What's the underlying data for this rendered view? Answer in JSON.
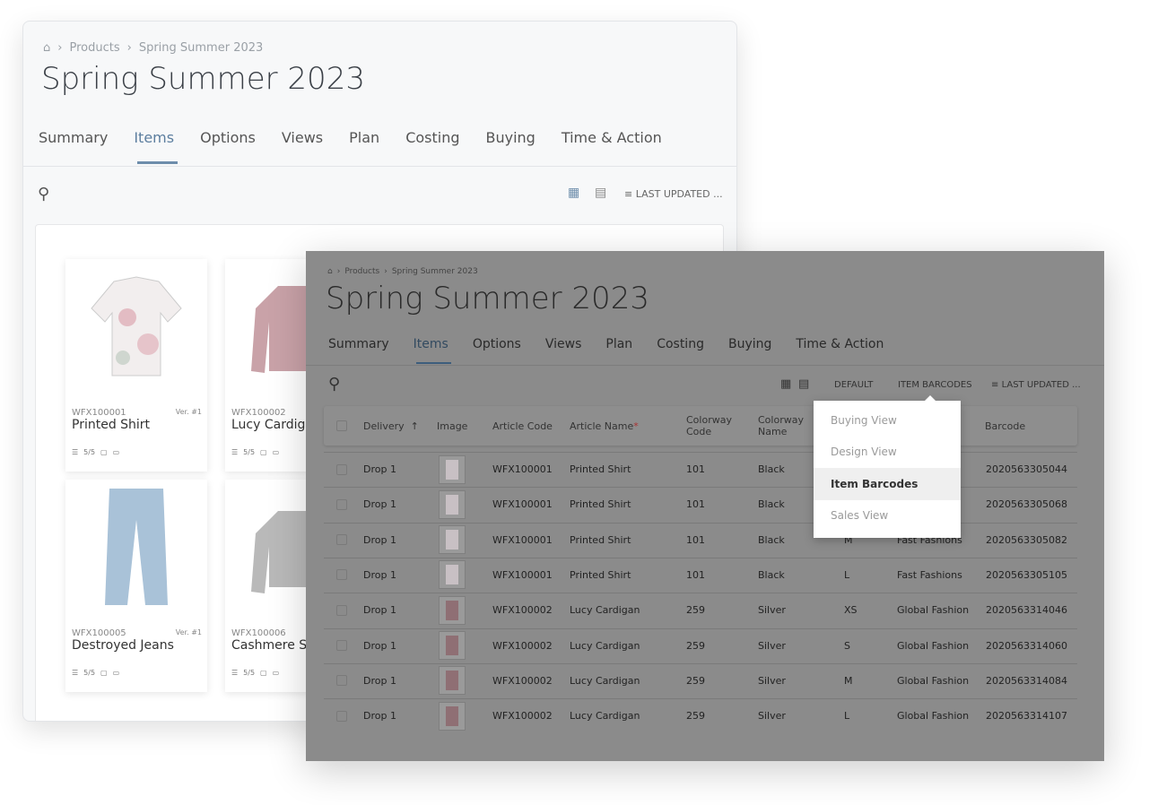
{
  "back": {
    "breadcrumb": [
      "Products",
      "Spring Summer 2023"
    ],
    "title": "Spring Summer 2023",
    "tabs": [
      "Summary",
      "Items",
      "Options",
      "Views",
      "Plan",
      "Costing",
      "Buying",
      "Time & Action"
    ],
    "active_tab": "Items",
    "sort_label": "LAST UPDATED ...",
    "cards": [
      {
        "code": "WFX100001",
        "version": "Ver. #1",
        "name": "Printed Shirt",
        "count": "5/5"
      },
      {
        "code": "WFX100002",
        "version": "",
        "name": "Lucy Cardigan",
        "count": "5/5"
      },
      {
        "code": "WFX100005",
        "version": "Ver. #1",
        "name": "Destroyed Jeans",
        "count": "5/5"
      },
      {
        "code": "WFX100006",
        "version": "",
        "name": "Cashmere Sweater",
        "count": "5/5"
      }
    ]
  },
  "front": {
    "breadcrumb": [
      "Products",
      "Spring Summer 2023"
    ],
    "title": "Spring Summer 2023",
    "tabs": [
      "Summary",
      "Items",
      "Options",
      "Views",
      "Plan",
      "Costing",
      "Buying",
      "Time & Action"
    ],
    "active_tab": "Items",
    "view_default": "DEFAULT",
    "view_current": "ITEM BARCODES",
    "sort_label": "LAST UPDATED ...",
    "columns": [
      "Delivery",
      "Image",
      "Article Code",
      "Article Name",
      "Colorway Code",
      "Colorway Name",
      "",
      "",
      "Barcode"
    ],
    "required_mark": "*",
    "rows": [
      [
        "Drop 1",
        "WFX100001",
        "Printed Shirt",
        "101",
        "Black",
        "",
        "",
        "2020563305044"
      ],
      [
        "Drop 1",
        "WFX100001",
        "Printed Shirt",
        "101",
        "Black",
        "",
        "",
        "2020563305068"
      ],
      [
        "Drop 1",
        "WFX100001",
        "Printed Shirt",
        "101",
        "Black",
        "M",
        "Fast Fashions",
        "2020563305082"
      ],
      [
        "Drop 1",
        "WFX100001",
        "Printed Shirt",
        "101",
        "Black",
        "L",
        "Fast Fashions",
        "2020563305105"
      ],
      [
        "Drop 1",
        "WFX100002",
        "Lucy Cardigan",
        "259",
        "Silver",
        "XS",
        "Global Fashion",
        "2020563314046"
      ],
      [
        "Drop 1",
        "WFX100002",
        "Lucy Cardigan",
        "259",
        "Silver",
        "S",
        "Global Fashion",
        "2020563314060"
      ],
      [
        "Drop 1",
        "WFX100002",
        "Lucy Cardigan",
        "259",
        "Silver",
        "M",
        "Global Fashion",
        "2020563314084"
      ],
      [
        "Drop 1",
        "WFX100002",
        "Lucy Cardigan",
        "259",
        "Silver",
        "L",
        "Global Fashion",
        "2020563314107"
      ]
    ],
    "view_menu": [
      "Buying View",
      "Design View",
      "Item Barcodes",
      "Sales View"
    ],
    "view_menu_selected": "Item Barcodes"
  }
}
